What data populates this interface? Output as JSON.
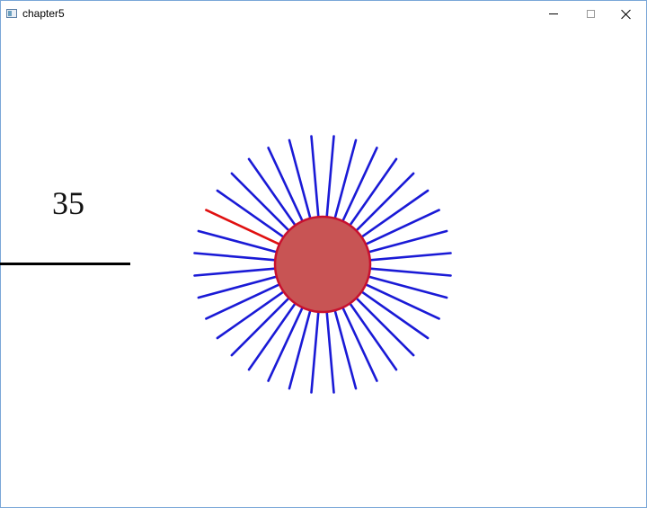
{
  "window": {
    "title": "chapter5",
    "app_icon": "window-app-icon",
    "buttons": {
      "minimize": "minimize-icon",
      "maximize": "maximize-icon",
      "close": "close-icon"
    }
  },
  "game": {
    "score": "35",
    "colors": {
      "background": "#ffffff",
      "pin": "#1a1ad6",
      "pin_active": "#e01010",
      "core_fill": "#c85454",
      "core_stroke": "#c8102e",
      "launcher": "#000000"
    },
    "pins_total": 36,
    "active_pin_index": 1
  }
}
